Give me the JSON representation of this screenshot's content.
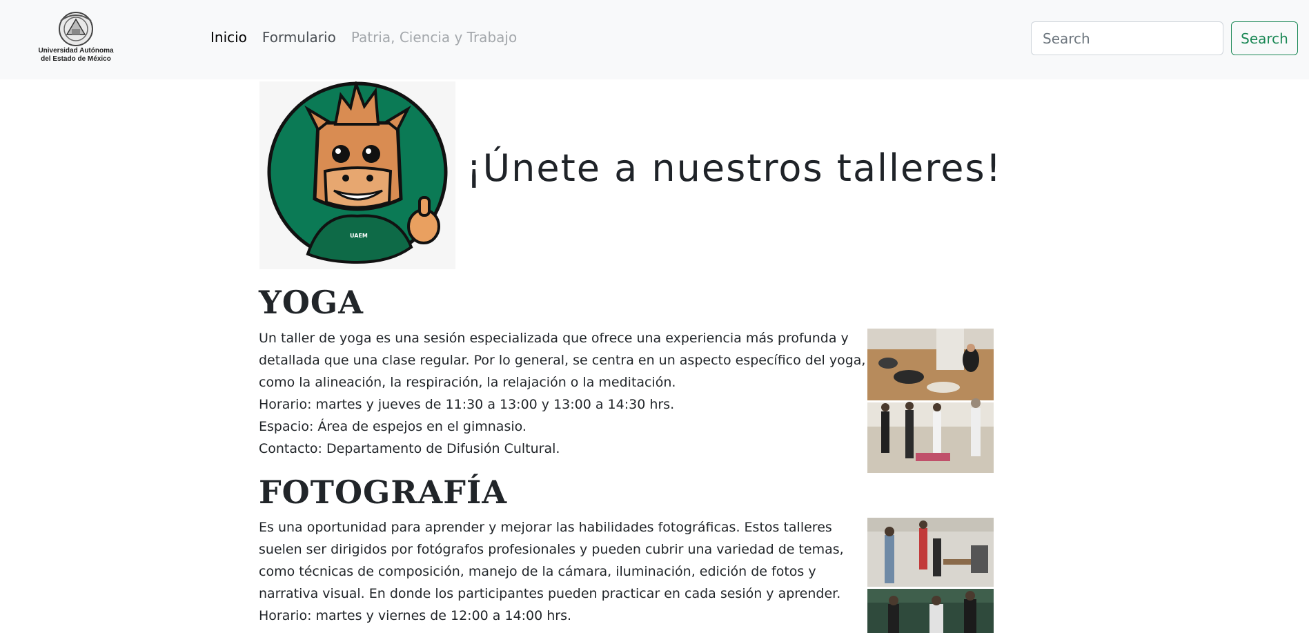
{
  "navbar": {
    "brand_line1": "Universidad Autónoma",
    "brand_line2": "del Estado de México",
    "links": [
      {
        "label": "Inicio",
        "state": "active"
      },
      {
        "label": "Formulario",
        "state": "normal"
      },
      {
        "label": "Patria, Ciencia y Trabajo",
        "state": "disabled"
      }
    ],
    "search_placeholder": "Search",
    "search_button": "Search"
  },
  "hero": {
    "title": "¡Únete a nuestros talleres!",
    "mascot_label": "UAEM"
  },
  "sections": [
    {
      "title": "YOGA",
      "lines": [
        "Un taller de yoga es una sesión especializada que ofrece una experiencia más profunda y",
        "detallada que una clase regular. Por lo general, se centra en un aspecto específico del yoga,",
        "como la alineación, la respiración, la relajación o la meditación.",
        "Horario: martes y jueves de 11:30 a 13:00 y 13:00 a 14:30 hrs.",
        "Espacio: Área de espejos en el gimnasio.",
        "Contacto: Departamento de Difusión Cultural."
      ]
    },
    {
      "title": "FOTOGRAFÍA",
      "lines": [
        "Es una oportunidad para aprender y mejorar las habilidades fotográficas. Estos talleres",
        "suelen ser dirigidos por fotógrafos profesionales y pueden cubrir una variedad de temas,",
        "como técnicas de composición, manejo de la cámara, iluminación, edición de fotos y",
        "narrativa visual. En donde los participantes pueden practicar en cada sesión y aprender.",
        "Horario: martes y viernes de 12:00 a 14:00 hrs."
      ]
    }
  ],
  "colors": {
    "navbar_bg": "#f8f9fa",
    "accent_green": "#198754",
    "mascot_green": "#0b7a55"
  }
}
